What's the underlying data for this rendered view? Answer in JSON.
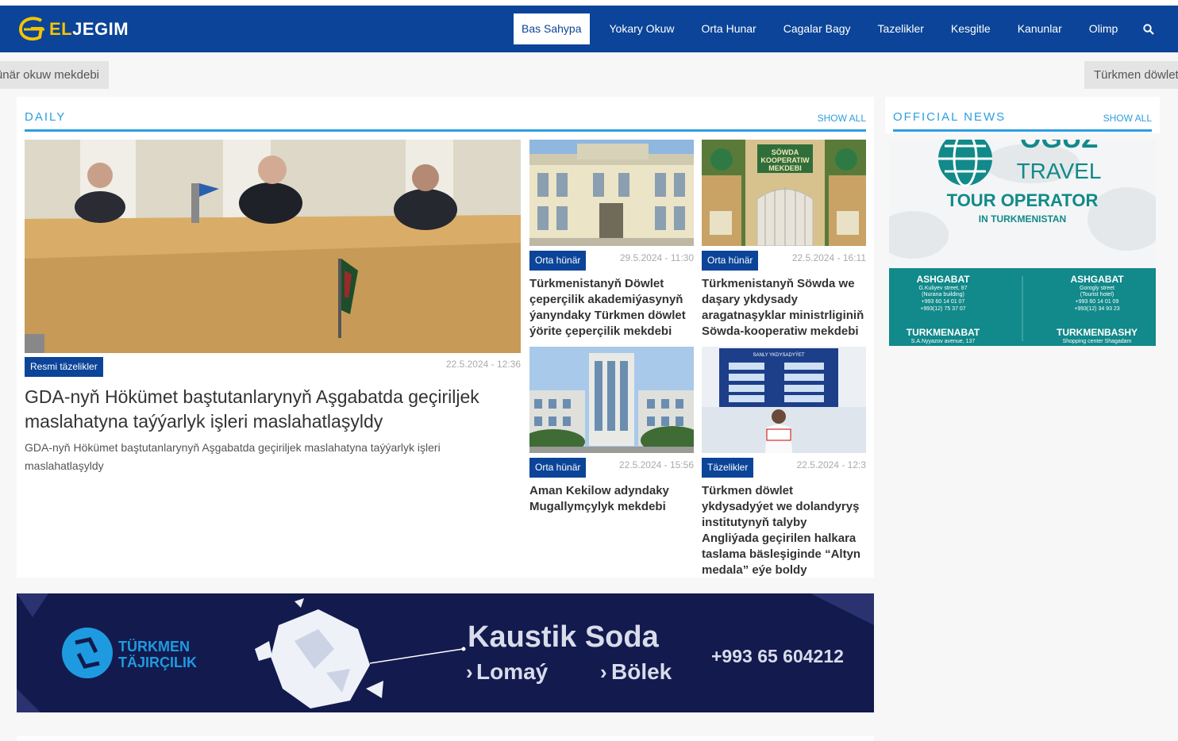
{
  "site": {
    "logo_text_highlight": "EL",
    "logo_text_rest": "JEGIM",
    "brand_color": "#0b4498",
    "accent_color": "#2d9ee0"
  },
  "nav": {
    "items": [
      {
        "label": "Bas Sahypa",
        "active": true
      },
      {
        "label": "Yokary Okuw"
      },
      {
        "label": "Orta Hunar"
      },
      {
        "label": "Cagalar Bagy"
      },
      {
        "label": "Tazelikler"
      },
      {
        "label": "Kesgitle"
      },
      {
        "label": "Kanunlar"
      },
      {
        "label": "Olimp"
      }
    ],
    "search_icon": "search-icon"
  },
  "ticker": {
    "left_text": "hünär okuw mekdebi",
    "right_text": "Türkmen döwlet"
  },
  "daily": {
    "title": "DAILY",
    "show_all": "SHOW ALL",
    "main": {
      "category": "Resmi täzelikler",
      "date": "22.5.2024 - 12:36",
      "title": "GDA-nyň Hökümet baştutanlarynyň Aşgabatda geçiriljek maslahatyna taýýarlyk işleri maslahatlaşyldy",
      "description": "GDA-nyň Hökümet baştutanlarynyň Aşgabatda geçiriljek maslahatyna taýýarlyk işleri maslahatlaşyldy"
    },
    "cards": [
      {
        "category": "Orta hünär",
        "date": "29.5.2024 - 11:30",
        "title": "Türkmenistanyň Döwlet çeperçilik akademiýasynyň ýanyndaky Türkmen döwlet ýörite çeperçilik mekdebi"
      },
      {
        "category": "Orta hünär",
        "date": "22.5.2024 - 16:11",
        "title": "Türkmenistanyň Söwda we daşary ykdysady aragatnaşyklar ministrliginiň Söwda-kooperatiw mekdebi"
      },
      {
        "category": "Orta hünär",
        "date": "22.5.2024 - 15:56",
        "title": "Aman Kekilow adyndaky Mugallymçylyk mekdebi"
      },
      {
        "category": "Täzelikler",
        "date": "22.5.2024 - 12:3",
        "title": "Türkmen döwlet ykdysadyýet we dolandyryş institutynyň talyby Angliýada geçirilen halkara taslama bäsleşiginde “Altyn medala” eýe boldy"
      }
    ],
    "sign_text": "SÖWDA KOOPERATIW MEKDEBI",
    "board_text": "SANLY YKDYSADYÝET"
  },
  "official": {
    "title": "OFFICIAL NEWS",
    "show_all": "SHOW ALL",
    "ad": {
      "brand_top": "OGUZ",
      "brand_bottom": "TRAVEL",
      "headline": "TOUR OPERATOR",
      "subline": "IN TURKMENISTAN",
      "offices": [
        {
          "city": "ASHGABAT",
          "lines": [
            "G.Kuliyev street, 87",
            "(Nurana building)",
            "+993 60 14 01 07",
            "+993(12) 75 37 07"
          ]
        },
        {
          "city": "ASHGABAT",
          "lines": [
            "Gorogly street",
            "(Tourist hotel)",
            "+993 60 14 01 09",
            "+993(12) 34 93 23"
          ]
        },
        {
          "city": "TURKMENABAT",
          "lines": [
            "S.A.Nyyazov avenue, 137"
          ]
        },
        {
          "city": "TURKMENBASHY",
          "lines": [
            "Shopping center Shagadam"
          ]
        }
      ]
    }
  },
  "banner": {
    "company_line1": "TÜRKMEN",
    "company_line2": "TÄJIRÇILIK",
    "product": "Kaustik Soda",
    "option1": "Lomaý",
    "option2": "Bölek",
    "phone": "+993 65 604212"
  }
}
